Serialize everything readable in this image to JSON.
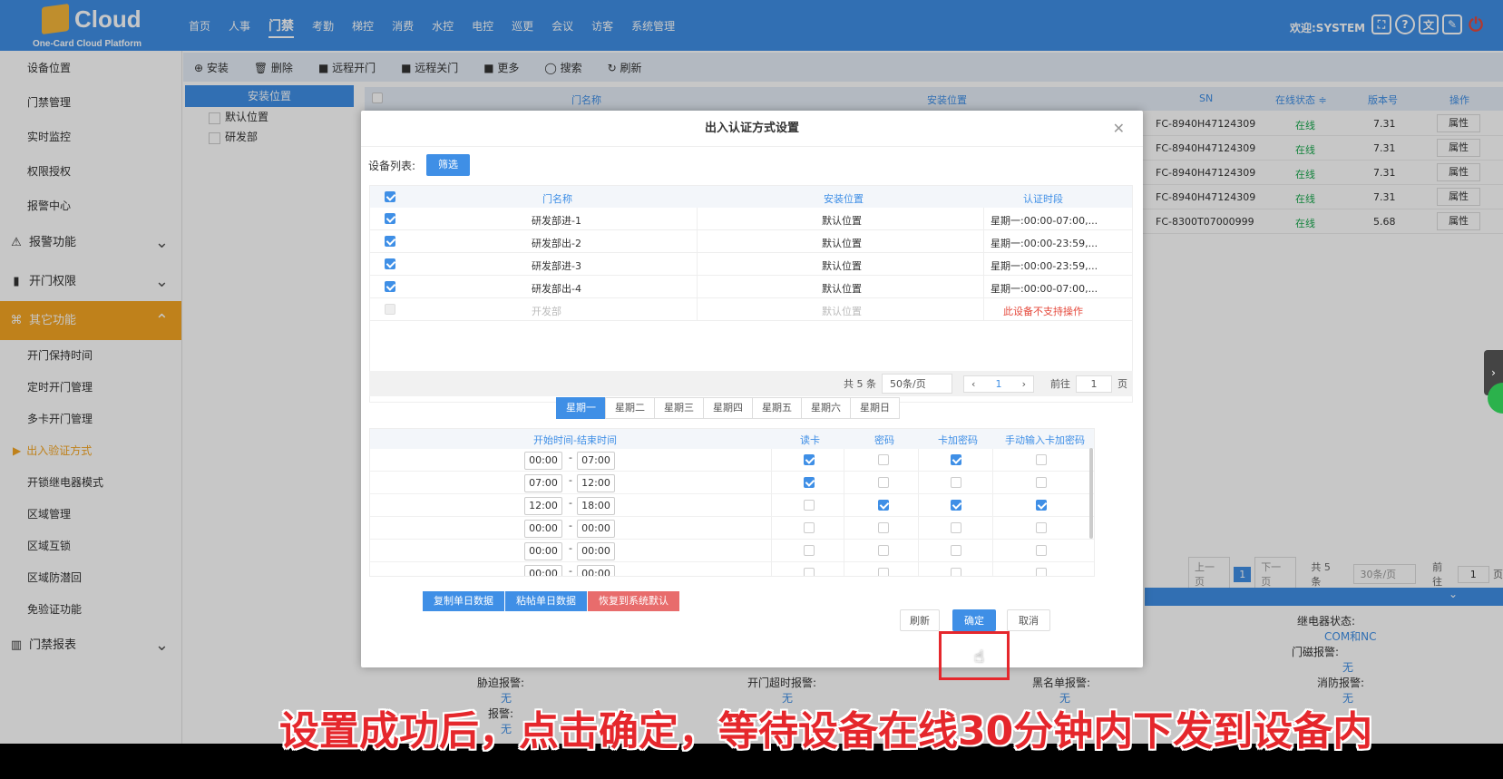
{
  "header": {
    "logo_text": "Cloud",
    "logo_subtitle": "One-Card Cloud Platform",
    "nav": [
      "首页",
      "人事",
      "门禁",
      "考勤",
      "梯控",
      "消费",
      "水控",
      "电控",
      "巡更",
      "会议",
      "访客",
      "系统管理"
    ],
    "nav_active": "门禁",
    "welcome": "欢迎:SYSTEM"
  },
  "sidebar": {
    "top_items": [
      "设备位置",
      "门禁管理",
      "实时监控",
      "权限授权",
      "报警中心"
    ],
    "groups": [
      {
        "label": "报警功能",
        "icon": "alarm-icon"
      },
      {
        "label": "开门权限",
        "icon": "door-icon"
      },
      {
        "label": "其它功能",
        "icon": "apps-icon"
      }
    ],
    "sub_items": [
      "开门保持时间",
      "定时开门管理",
      "多卡开门管理",
      "出入验证方式",
      "开锁继电器模式",
      "区域管理",
      "区域互锁",
      "区域防潜回",
      "免验证功能"
    ],
    "current_sub": "出入验证方式",
    "report_group": "门禁报表",
    "accent": "#f5a623"
  },
  "toolbar": {
    "items": [
      "⊕ 安装",
      "🗑 删除",
      "■ 远程开门",
      "■ 远程关门",
      "■ 更多",
      "◯ 搜索",
      "↻ 刷新"
    ]
  },
  "tree": {
    "header": "安装位置",
    "items": [
      "默认位置",
      "研发部"
    ]
  },
  "grid": {
    "headers": [
      "门名称",
      "安装位置",
      "SN",
      "在线状态 ≑",
      "版本号",
      "操作"
    ],
    "rows": [
      {
        "sn": "FC-8940H47124309",
        "status": "在线",
        "ver": "7.31",
        "op": "属性"
      },
      {
        "sn": "FC-8940H47124309",
        "status": "在线",
        "ver": "7.31",
        "op": "属性"
      },
      {
        "sn": "FC-8940H47124309",
        "status": "在线",
        "ver": "7.31",
        "op": "属性"
      },
      {
        "sn": "FC-8940H47124309",
        "status": "在线",
        "ver": "7.31",
        "op": "属性"
      },
      {
        "sn": "FC-8300T07000999",
        "status": "在线",
        "ver": "5.68",
        "op": "属性"
      }
    ],
    "pager": {
      "prev": "上一页",
      "page": "1",
      "next": "下一页",
      "total": "共 5 条",
      "size": "30条/页",
      "goto": "前往",
      "goto_val": "1",
      "unit": "页"
    }
  },
  "details": {
    "relay_label": "继电器状态:",
    "relay_value": "COM和NC",
    "door_alarm_label": "门磁报警:",
    "door_alarm_value": "无",
    "duress_label": "胁迫报警:",
    "duress_value": "无",
    "timeout_label": "开门超时报警:",
    "timeout_value": "无",
    "blacklist_label": "黑名单报警:",
    "blacklist_value": "无",
    "fire_label": "消防报警:",
    "fire_value": "无",
    "other_label": "报警:",
    "other_value": "无"
  },
  "modal": {
    "title": "出入认证方式设置",
    "device_list_label": "设备列表:",
    "filter_btn": "筛选",
    "table_headers": [
      "门名称",
      "安装位置",
      "认证时段"
    ],
    "devices": [
      {
        "name": "研发部进-1",
        "loc": "默认位置",
        "period": "星期一:00:00-07:00,...",
        "checked": true,
        "disabled": false
      },
      {
        "name": "研发部出-2",
        "loc": "默认位置",
        "period": "星期一:00:00-23:59,...",
        "checked": true,
        "disabled": false
      },
      {
        "name": "研发部进-3",
        "loc": "默认位置",
        "period": "星期一:00:00-23:59,...",
        "checked": true,
        "disabled": false
      },
      {
        "name": "研发部出-4",
        "loc": "默认位置",
        "period": "星期一:00:00-07:00,...",
        "checked": true,
        "disabled": false
      },
      {
        "name": "开发部",
        "loc": "默认位置",
        "period": "此设备不支持操作",
        "checked": false,
        "disabled": true
      }
    ],
    "pager": {
      "total": "共 5 条",
      "size": "50条/页",
      "page": "1",
      "goto": "前往",
      "goto_val": "1",
      "unit": "页"
    },
    "days": [
      "星期一",
      "星期二",
      "星期三",
      "星期四",
      "星期五",
      "星期六",
      "星期日"
    ],
    "active_day": "星期一",
    "time_headers": [
      "开始时间-结束时间",
      "读卡",
      "密码",
      "卡加密码",
      "手动输入卡加密码"
    ],
    "time_rows": [
      {
        "start": "00:00",
        "end": "07:00",
        "card": true,
        "pwd": false,
        "cardpwd": true,
        "manual": false
      },
      {
        "start": "07:00",
        "end": "12:00",
        "card": true,
        "pwd": false,
        "cardpwd": false,
        "manual": false
      },
      {
        "start": "12:00",
        "end": "18:00",
        "card": false,
        "pwd": true,
        "cardpwd": true,
        "manual": true
      },
      {
        "start": "00:00",
        "end": "00:00",
        "card": false,
        "pwd": false,
        "cardpwd": false,
        "manual": false
      },
      {
        "start": "00:00",
        "end": "00:00",
        "card": false,
        "pwd": false,
        "cardpwd": false,
        "manual": false
      },
      {
        "start": "00:00",
        "end": "00:00",
        "card": false,
        "pwd": false,
        "cardpwd": false,
        "manual": false
      }
    ],
    "copy_btn": "复制单日数据",
    "paste_btn": "粘帖单日数据",
    "reset_btn": "恢复到系统默认",
    "refresh_btn": "刷新",
    "ok_btn": "确定",
    "cancel_btn": "取消"
  },
  "caption": "设置成功后，点击确定，等待设备在线30分钟内下发到设备内"
}
